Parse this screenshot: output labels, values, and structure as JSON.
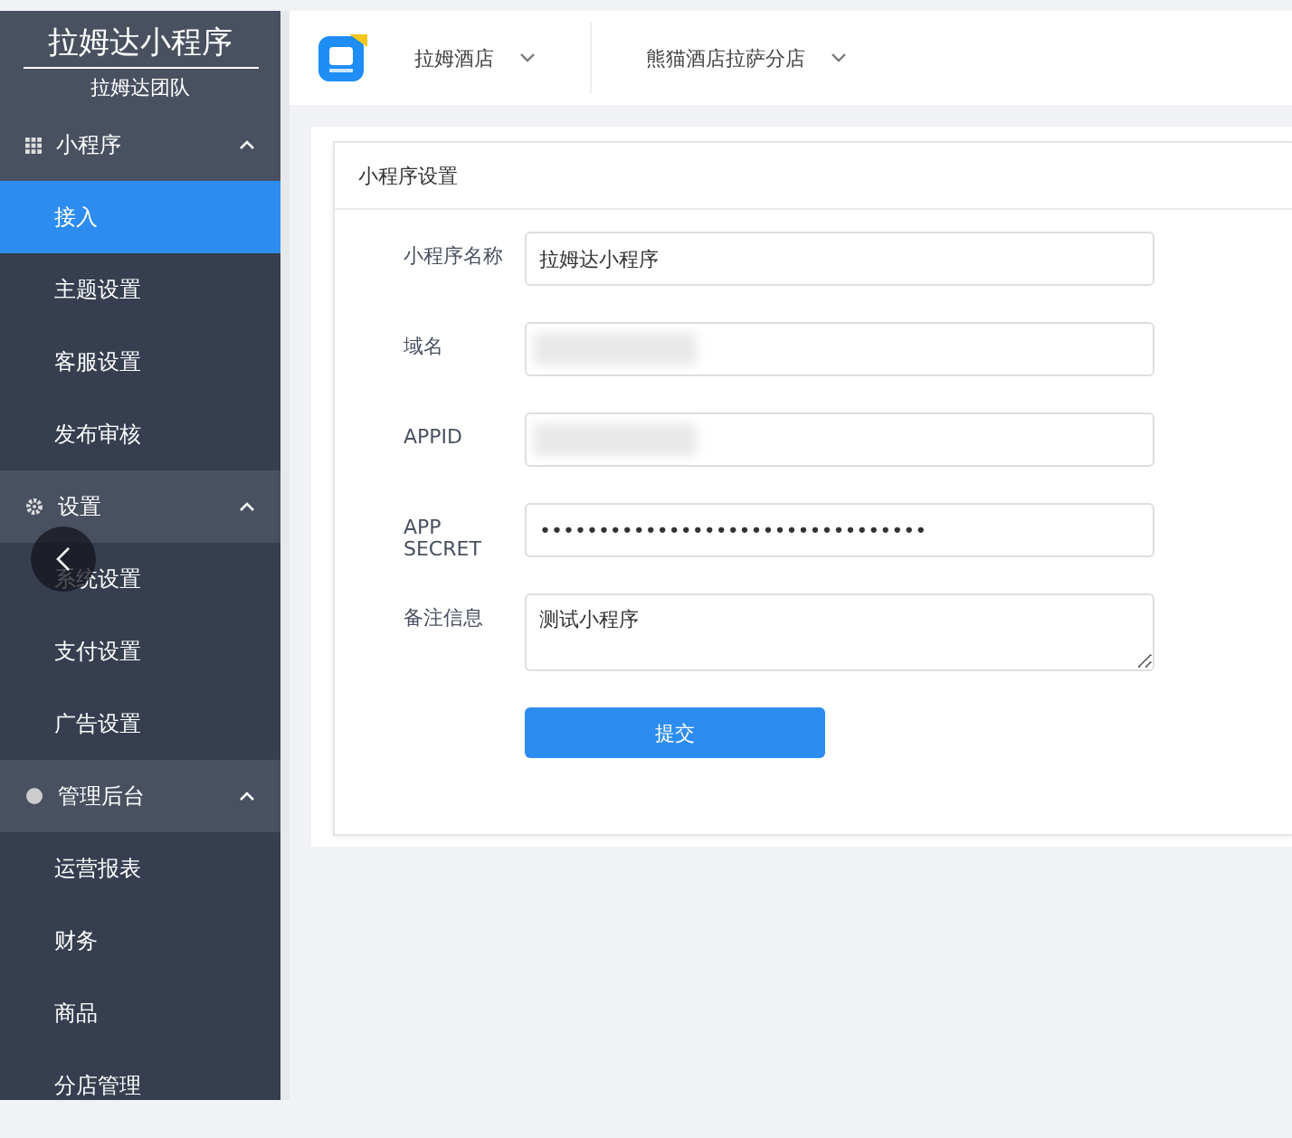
{
  "sidebar": {
    "title": "拉姆达小程序",
    "subtitle": "拉姆达团队",
    "groups": [
      {
        "label": "小程序",
        "expanded": true,
        "items": [
          {
            "label": "接入",
            "selected": true
          },
          {
            "label": "主题设置",
            "selected": false
          },
          {
            "label": "客服设置",
            "selected": false
          },
          {
            "label": "发布审核",
            "selected": false
          }
        ]
      },
      {
        "label": "设置",
        "expanded": true,
        "items": [
          {
            "label": "系统设置",
            "selected": false
          },
          {
            "label": "支付设置",
            "selected": false
          },
          {
            "label": "广告设置",
            "selected": false
          }
        ]
      },
      {
        "label": "管理后台",
        "expanded": true,
        "items": [
          {
            "label": "运营报表",
            "selected": false
          },
          {
            "label": "财务",
            "selected": false
          },
          {
            "label": "商品",
            "selected": false
          },
          {
            "label": "分店管理",
            "selected": false
          }
        ]
      }
    ]
  },
  "topbar": {
    "selectors": [
      "拉姆酒店",
      "熊猫酒店拉萨分店"
    ]
  },
  "panel": {
    "title": "小程序设置",
    "fields": [
      {
        "kind": "text",
        "label": "小程序名称",
        "value": "拉姆达小程序"
      },
      {
        "kind": "redacted",
        "label": "域名"
      },
      {
        "kind": "redacted",
        "label": "APPID"
      },
      {
        "kind": "password",
        "label": "APP SECRET",
        "value": "•••••••••••••••••••••••••••••••••"
      },
      {
        "kind": "textarea",
        "label": "备注信息",
        "value": "测试小程序"
      }
    ],
    "submit": "提交"
  }
}
